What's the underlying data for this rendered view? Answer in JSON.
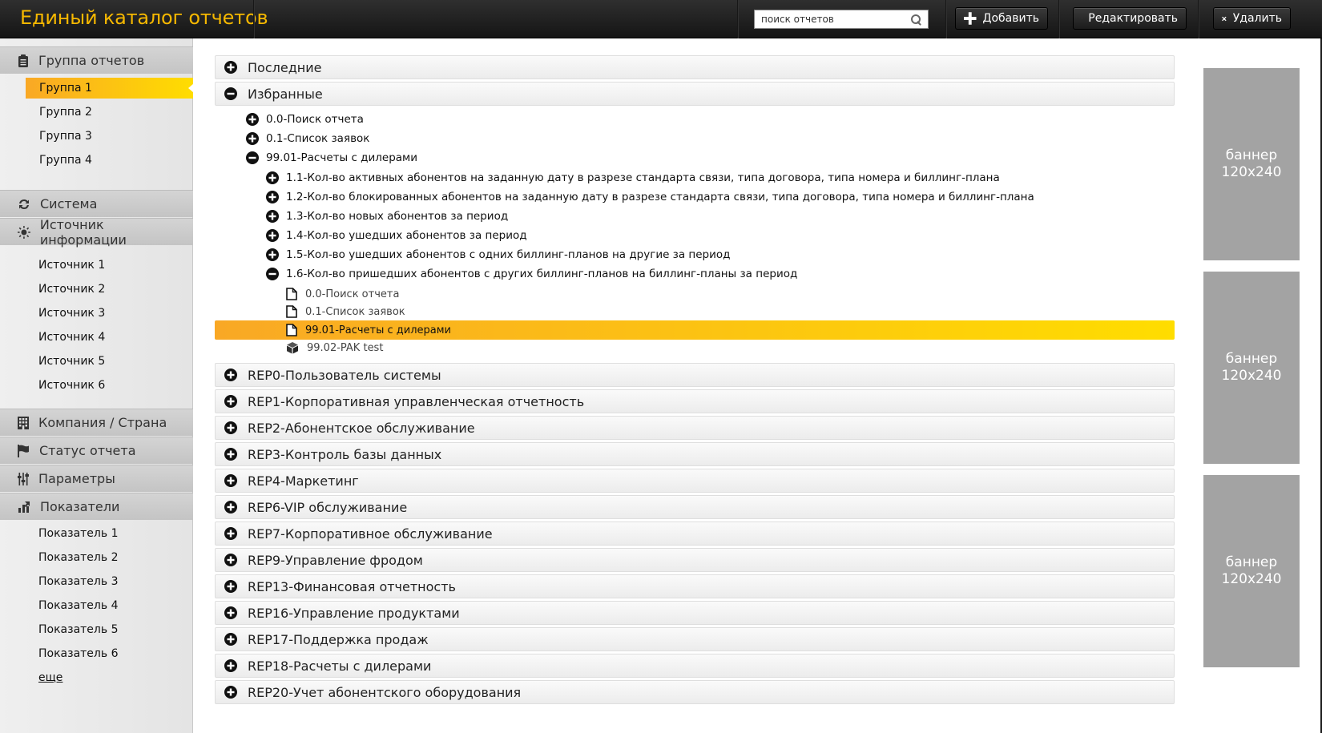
{
  "header": {
    "title": "Единый каталог отчетов",
    "search_placeholder": "поиск отчетов",
    "add_label": "Добавить",
    "edit_label": "Редактировать",
    "delete_label": "Удалить"
  },
  "sidebar": {
    "sections": [
      {
        "title": "Группа отчетов",
        "icon": "clipboard-icon"
      },
      {
        "title": "Система",
        "icon": "refresh-icon"
      },
      {
        "title": "Источник информации",
        "icon": "sun-icon"
      },
      {
        "title": "Компания / Страна",
        "icon": "building-icon"
      },
      {
        "title": "Статус отчета",
        "icon": "flag-icon"
      },
      {
        "title": "Параметры",
        "icon": "sliders-icon"
      },
      {
        "title": "Показатели",
        "icon": "bar-chart-icon"
      }
    ],
    "groups": [
      "Группа 1",
      "Группа 2",
      "Группа 3",
      "Группа 4"
    ],
    "active_group": "Группа 1",
    "sources": [
      "Источник 1",
      "Источник 2",
      "Источник 3",
      "Источник 4",
      "Источник 5",
      "Источник 6"
    ],
    "indicators": [
      "Показатель 1",
      "Показатель 2",
      "Показатель 3",
      "Показатель 4",
      "Показатель 5",
      "Показатель 6"
    ],
    "more_label": "еще"
  },
  "tree": {
    "recent": {
      "label": "Последние",
      "state": "collapsed"
    },
    "favorites": {
      "label": "Избранные",
      "state": "expanded",
      "children": [
        {
          "label": "0.0-Поиск отчета",
          "state": "collapsed"
        },
        {
          "label": "0.1-Список заявок",
          "state": "collapsed"
        },
        {
          "label": "99.01-Расчеты с дилерами",
          "state": "expanded"
        }
      ],
      "sub_children": [
        {
          "label": "1.1-Кол-во активных абонентов на заданную дату в разрезе стандарта связи, типа договора, типа номера и биллинг-плана",
          "state": "collapsed"
        },
        {
          "label": "1.2-Кол-во блокированных абонентов на заданную дату в разрезе стандарта связи, типа договора, типа номера и биллинг-плана",
          "state": "collapsed"
        },
        {
          "label": "1.3-Кол-во новых абонентов за период",
          "state": "collapsed"
        },
        {
          "label": "1.4-Кол-во ушедших абонентов за период",
          "state": "collapsed"
        },
        {
          "label": "1.5-Кол-во ушедших абонентов с одних биллинг-планов на другие за период",
          "state": "collapsed"
        },
        {
          "label": "1.6-Кол-во пришедших абонентов с других биллинг-планов на биллинг-планы за период",
          "state": "expanded"
        }
      ],
      "leaves": [
        {
          "label": "0.0-Поиск отчета",
          "icon": "document-icon"
        },
        {
          "label": "0.1-Список заявок",
          "icon": "document-icon"
        },
        {
          "label": "99.01-Расчеты с дилерами",
          "icon": "document-icon",
          "selected": true
        },
        {
          "label": "99.02-PAK test",
          "icon": "cube-icon"
        }
      ]
    },
    "groups": [
      "REP0-Пользователь системы",
      "REP1-Корпоративная управленческая отчетность",
      "REP2-Абонентское обслуживание",
      "REP3-Контроль базы данных",
      "REP4-Маркетинг",
      "REP6-VIP обслуживание",
      "REP7-Корпоративное обслуживание",
      "REP9-Управление фродом",
      "REP13-Финансовая отчетность",
      "REP16-Управление продуктами",
      "REP17-Поддержка продаж",
      "REP18-Расчеты с дилерами",
      "REP20-Учет абонентского оборудования"
    ]
  },
  "banners": [
    "баннер\n120x240",
    "баннер\n120x240",
    "баннер\n120x240"
  ],
  "colors": {
    "accent": "#f6b800",
    "selection_start": "#f9a825",
    "selection_end": "#ffdd00",
    "banner": "#a3a3a3"
  }
}
